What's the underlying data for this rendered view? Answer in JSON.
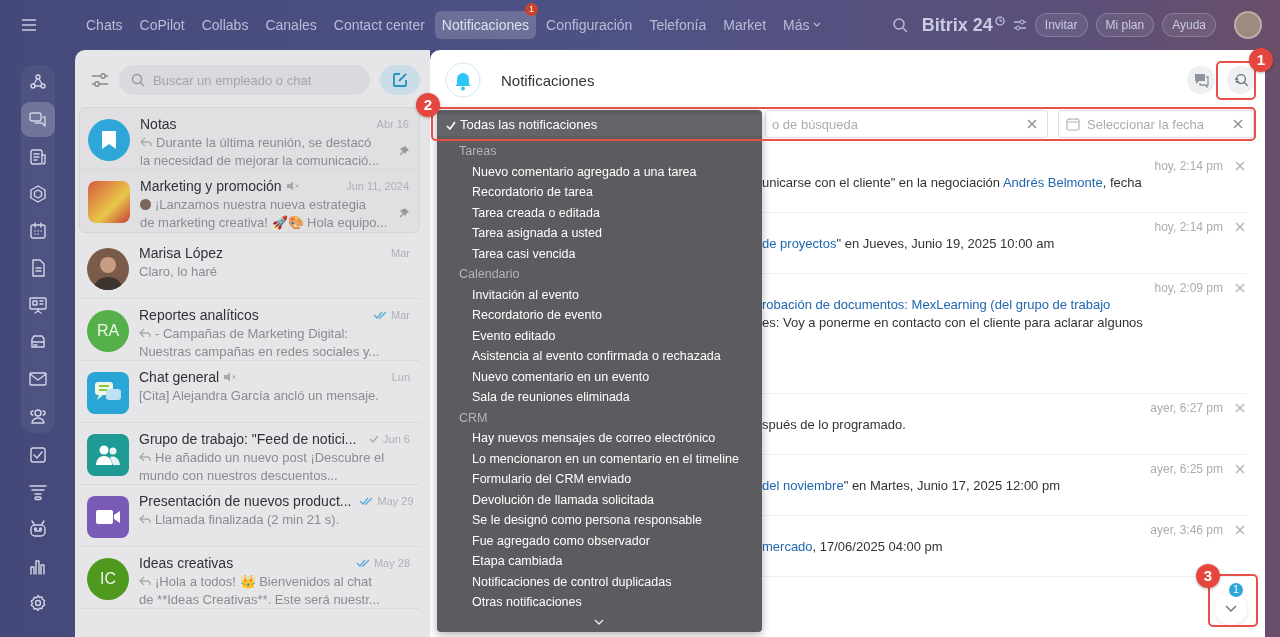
{
  "top_nav": {
    "items": [
      {
        "label": "Chats",
        "selected": false
      },
      {
        "label": "CoPilot",
        "selected": false
      },
      {
        "label": "Collabs",
        "selected": false
      },
      {
        "label": "Canales",
        "selected": false
      },
      {
        "label": "Contact center",
        "selected": false
      },
      {
        "label": "Notificaciones",
        "selected": true,
        "badge": "1"
      },
      {
        "label": "Configuración",
        "selected": false
      },
      {
        "label": "Telefonía",
        "selected": false
      },
      {
        "label": "Market",
        "selected": false
      },
      {
        "label": "Más",
        "selected": false,
        "dropdown": true
      }
    ],
    "logo": "Bitrix 24",
    "buttons": [
      "Invitar",
      "Mi plan",
      "Ayuda"
    ]
  },
  "rail": [
    {
      "selected": false
    },
    {
      "selected": true
    },
    {
      "selected": false
    },
    {
      "selected": false
    },
    {
      "selected": false
    },
    {
      "selected": false
    },
    {
      "selected": false
    },
    {
      "selected": false
    },
    {
      "selected": false
    },
    {
      "selected": false
    },
    {
      "selected": false
    },
    {
      "selected": false
    },
    {
      "selected": false
    },
    {
      "selected": false
    },
    {
      "selected": false
    }
  ],
  "chat_list": {
    "search_placeholder": "Buscar un empleado o chat",
    "chats": [
      {
        "name": "Notas",
        "time": "Abr 16",
        "avatar": {
          "kind": "bookmark",
          "color": "#2fa6d8"
        },
        "reply": true,
        "lines": [
          "Durante la última reunión, se destacó",
          "la necesidad de mejorar la comunicació..."
        ],
        "pinned": true
      },
      {
        "name": "Marketing y promoción",
        "time": "Jun 11, 2024",
        "avatar": {
          "kind": "photo-square"
        },
        "author_avatar": true,
        "muted": true,
        "lines": [
          "¡Lanzamos nuestra nueva estrategia",
          "de marketing creativa! 🚀🎨 Hola equipo..."
        ],
        "pinned": true
      },
      {
        "name": "Marisa López",
        "time": "Mar",
        "avatar": {
          "kind": "photo-round"
        },
        "lines": [
          "Claro, lo haré"
        ]
      },
      {
        "name": "Reportes analíticos",
        "time": "Mar",
        "read": true,
        "avatar": {
          "kind": "initials",
          "text": "RA",
          "color": "#55b04a"
        },
        "reply": true,
        "lines": [
          "- Campañas de Marketing Digital:",
          "Nuestras campañas en redes sociales y..."
        ]
      },
      {
        "name": "Chat general",
        "time": "Lun",
        "muted": true,
        "avatar": {
          "kind": "chat-app",
          "color": "#2aa6d6"
        },
        "lines": [
          "[Cita] Alejandra García ancló un mensaje."
        ]
      },
      {
        "name": "Grupo de trabajo: \"Feed de notici...",
        "time": "Jun 6",
        "delivered": true,
        "avatar": {
          "kind": "group",
          "color": "#1f9a94"
        },
        "reply": true,
        "lines": [
          "He añadido un nuevo post ¡Descubre el",
          "mundo con nuestros descuentos..."
        ]
      },
      {
        "name": "Presentación de nuevos product...",
        "time": "May 29",
        "read": true,
        "avatar": {
          "kind": "video",
          "color": "#7a5bb8"
        },
        "reply": true,
        "lines": [
          "Llamada finalizada (2 min 21 s)."
        ]
      },
      {
        "name": "Ideas creativas",
        "time": "May 28",
        "read": true,
        "avatar": {
          "kind": "initials",
          "text": "IC",
          "color": "#4f9a1e"
        },
        "reply": true,
        "lines": [
          "¡Hola a todos! 👑 Bienvenidos al chat",
          "de **Ideas Creativas**. Este será nuestr..."
        ]
      }
    ]
  },
  "notifications": {
    "title": "Notificaciones",
    "filter": {
      "options": [
        {
          "kind": "option",
          "label": "Todas las notificaciones",
          "selected": true
        },
        {
          "kind": "group",
          "label": "Tareas"
        },
        {
          "kind": "option",
          "label": "Nuevo comentario agregado a una tarea",
          "selected": false
        },
        {
          "kind": "option",
          "label": "Recordatorio de tarea",
          "selected": false
        },
        {
          "kind": "option",
          "label": "Tarea creada o editada",
          "selected": false
        },
        {
          "kind": "option",
          "label": "Tarea asignada a usted",
          "selected": false
        },
        {
          "kind": "option",
          "label": "Tarea casi vencida",
          "selected": false
        },
        {
          "kind": "group",
          "label": "Calendario"
        },
        {
          "kind": "option",
          "label": "Invitación al evento",
          "selected": false
        },
        {
          "kind": "option",
          "label": "Recordatorio de evento",
          "selected": false
        },
        {
          "kind": "option",
          "label": "Evento editado",
          "selected": false
        },
        {
          "kind": "option",
          "label": "Asistencia al evento confirmada o rechazada",
          "selected": false
        },
        {
          "kind": "option",
          "label": "Nuevo comentario en un evento",
          "selected": false
        },
        {
          "kind": "option",
          "label": "Sala de reuniones eliminada",
          "selected": false
        },
        {
          "kind": "group",
          "label": "CRM"
        },
        {
          "kind": "option",
          "label": "Hay nuevos mensajes de correo electrónico",
          "selected": false
        },
        {
          "kind": "option",
          "label": "Lo mencionaron en un comentario en el timeline",
          "selected": false
        },
        {
          "kind": "option",
          "label": "Formulario del CRM enviado",
          "selected": false
        },
        {
          "kind": "option",
          "label": "Devolución de llamada solicitada",
          "selected": false
        },
        {
          "kind": "option",
          "label": "Se le designó como persona responsable",
          "selected": false
        },
        {
          "kind": "option",
          "label": "Fue agregado como observador",
          "selected": false
        },
        {
          "kind": "option",
          "label": "Etapa cambiada",
          "selected": false
        },
        {
          "kind": "option",
          "label": "Notificaciones de control duplicadas",
          "selected": false
        },
        {
          "kind": "option",
          "label": "Otras notificaciones",
          "selected": false
        }
      ],
      "search_placeholder": "o de búsqueda",
      "date_placeholder": "Seleccionar la fecha"
    },
    "items": [
      {
        "time": "hoy, 2:14 pm",
        "lines": [
          [
            {
              "kind": "text",
              "text": "unicarse con el cliente\" en la negociación "
            },
            {
              "kind": "link",
              "text": "Andrés Belmonte"
            },
            {
              "kind": "text",
              "text": ", fecha"
            }
          ]
        ]
      },
      {
        "time": "hoy, 2:14 pm",
        "lines": [
          [
            {
              "kind": "link",
              "text": "de proyectos"
            },
            {
              "kind": "text",
              "text": "\" en Jueves, Junio 19, 2025 10:00 am"
            }
          ]
        ]
      },
      {
        "time": "hoy, 2:09 pm",
        "lines": [
          [
            {
              "kind": "link",
              "text": "robación de documentos: MexLearning (del grupo de trabajo"
            }
          ],
          [
            {
              "kind": "text",
              "text": "es: Voy a ponerme en contacto con el cliente para aclarar algunos"
            }
          ]
        ]
      },
      {
        "time": "ayer, 6:27 pm",
        "lines": [
          [
            {
              "kind": "text",
              "text": "spués de lo programado."
            }
          ]
        ]
      },
      {
        "time": "ayer, 6:25 pm",
        "lines": [
          [
            {
              "kind": "link",
              "text": "del noviembre"
            },
            {
              "kind": "text",
              "text": "\" en Martes, Junio 17, 2025 12:00 pm"
            }
          ]
        ]
      },
      {
        "time": "ayer, 3:46 pm",
        "lines": [
          [
            {
              "kind": "link",
              "text": "mercado"
            },
            {
              "kind": "text",
              "text": ", 17/06/2025 04:00 pm"
            }
          ]
        ]
      }
    ],
    "scroll_badge": "1"
  },
  "callouts": [
    {
      "number": "1"
    },
    {
      "number": "2"
    },
    {
      "number": "3"
    }
  ]
}
